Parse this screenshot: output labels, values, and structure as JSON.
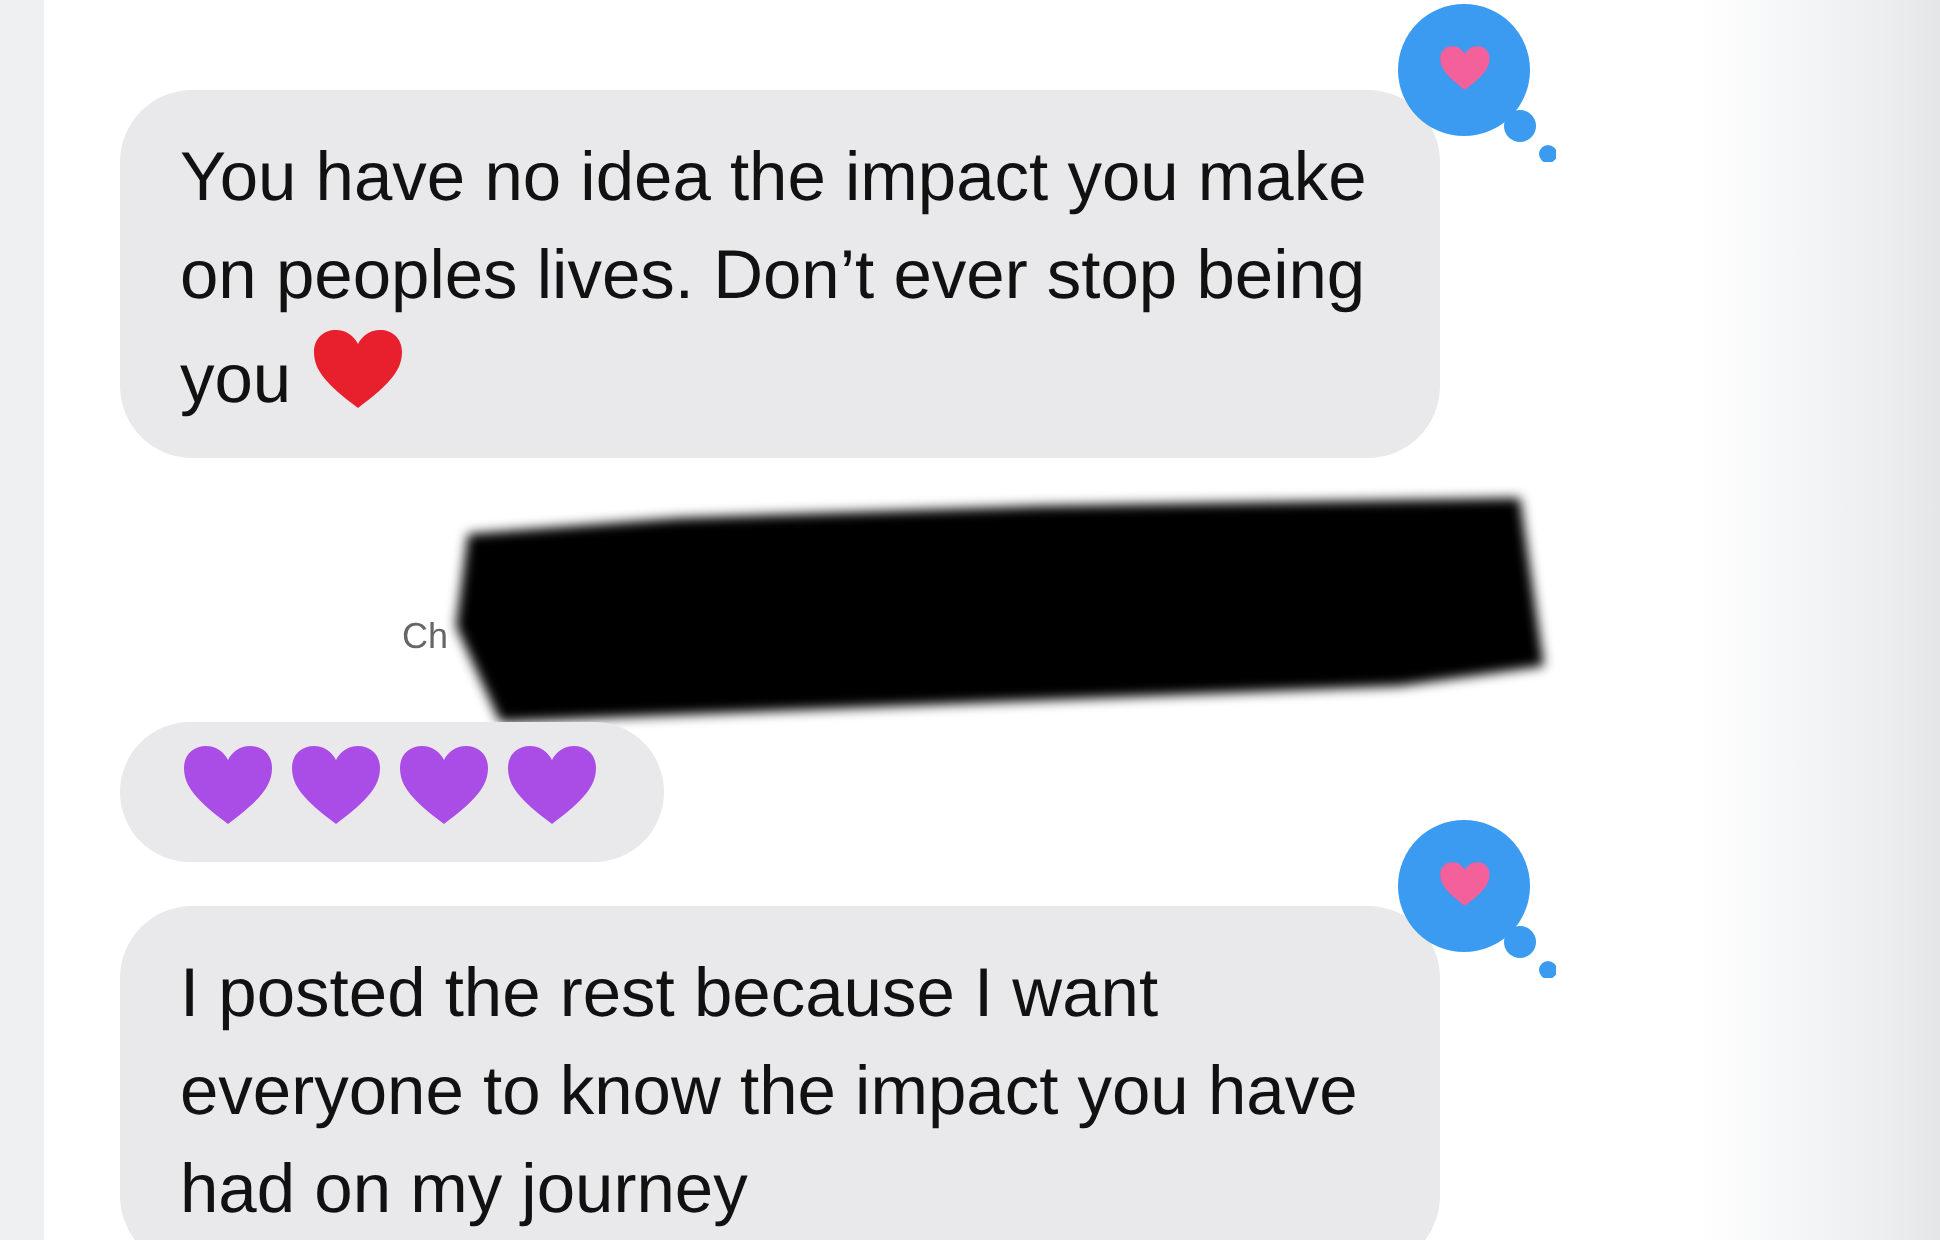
{
  "messages": [
    {
      "kind": "text",
      "text": "You have no idea the impact you make on peoples lives. Don’t ever stop being you",
      "emoji": [
        {
          "kind": "red-heart"
        }
      ],
      "reaction": {
        "kind": "heart"
      }
    },
    {
      "kind": "redacted",
      "visible_text": "Ch"
    },
    {
      "kind": "emoji",
      "emoji": [
        {
          "kind": "purple-heart"
        },
        {
          "kind": "purple-heart"
        },
        {
          "kind": "purple-heart"
        },
        {
          "kind": "purple-heart"
        }
      ]
    },
    {
      "kind": "text",
      "text": "I posted the rest because I want everyone to know the impact you have had on my journey",
      "reaction": {
        "kind": "heart"
      }
    }
  ]
}
